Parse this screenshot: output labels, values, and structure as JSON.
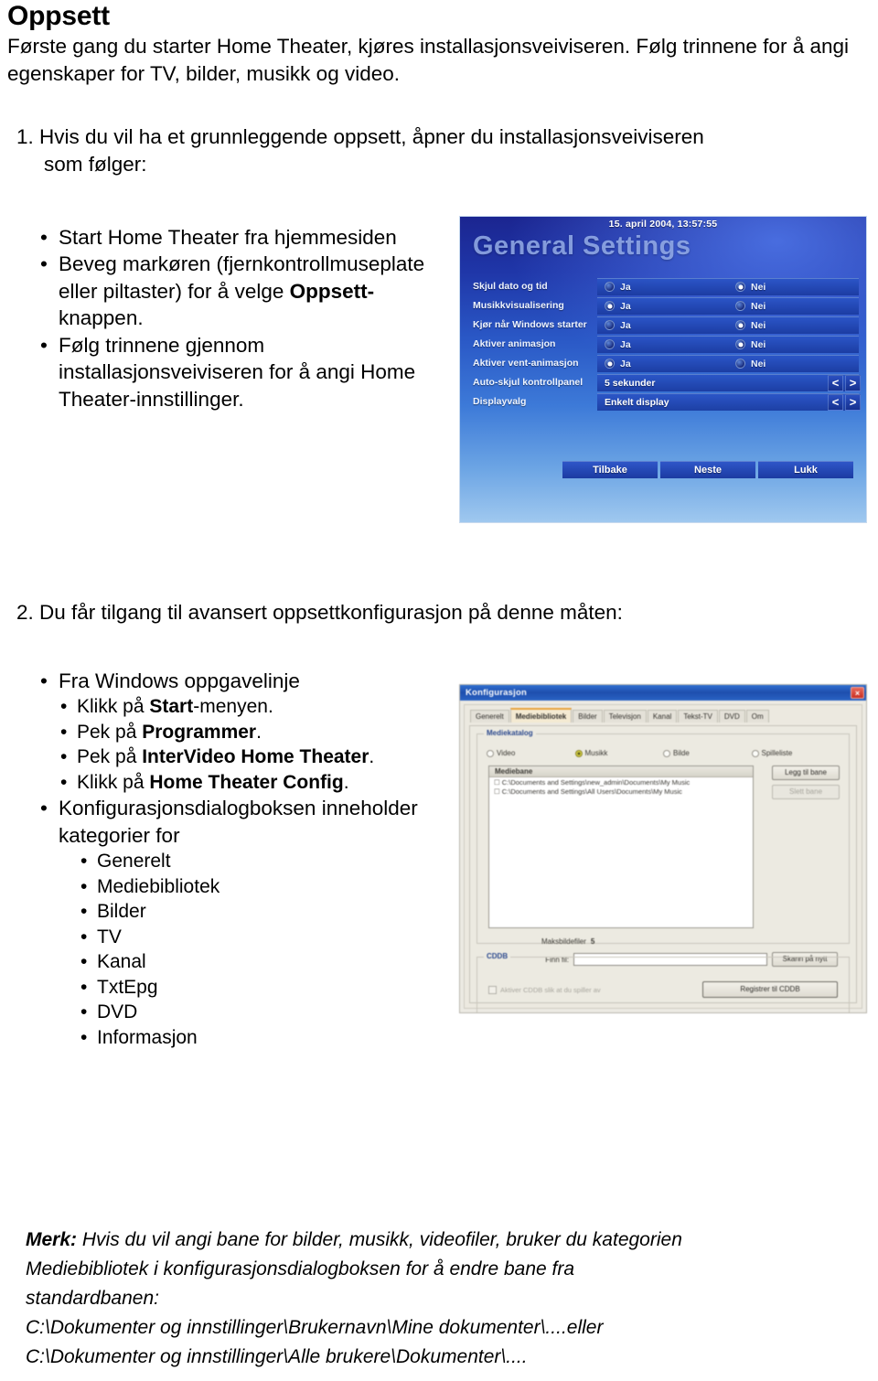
{
  "document": {
    "title": "Oppsett",
    "intro": "Første gang du starter Home Theater, kjøres installasjonsveiviseren. Følg trinnene for å angi egenskaper for TV, bilder, musikk og video.",
    "step1": {
      "number": "1.",
      "text": "Hvis du vil ha et grunnleggende oppsett, åpner du installasjonsveiviseren",
      "text_cont": "som følger:",
      "bullets": [
        {
          "parts": [
            {
              "t": "Start Home Theater fra hjemmesiden",
              "b": false
            }
          ]
        },
        {
          "parts": [
            {
              "t": "Beveg markøren (fjernkontrollmuseplate eller piltaster) for å velge ",
              "b": false
            },
            {
              "t": "Oppsett-",
              "b": true
            },
            {
              "t": "knappen.",
              "b": false
            }
          ]
        },
        {
          "parts": [
            {
              "t": "Følg trinnene gjennom installasjonsveiviseren for å angi Home Theater-innstillinger.",
              "b": false
            }
          ]
        }
      ]
    },
    "step2": {
      "number": "2.",
      "text": "Du får tilgang til avansert oppsettkonfigurasjon på denne måten:",
      "bullet_top": "Fra Windows oppgavelinje",
      "sub_bullets": [
        {
          "parts": [
            {
              "t": "Klikk på ",
              "b": false
            },
            {
              "t": "Start",
              "b": true
            },
            {
              "t": "-menyen.",
              "b": false
            }
          ]
        },
        {
          "parts": [
            {
              "t": "Pek på ",
              "b": false
            },
            {
              "t": "Programmer",
              "b": true
            },
            {
              "t": ".",
              "b": false
            }
          ]
        },
        {
          "parts": [
            {
              "t": "Pek på ",
              "b": false
            },
            {
              "t": "InterVideo Home Theater",
              "b": true
            },
            {
              "t": ".",
              "b": false
            }
          ]
        },
        {
          "parts": [
            {
              "t": "Klikk på ",
              "b": false
            },
            {
              "t": "Home Theater Config",
              "b": true
            },
            {
              "t": ".",
              "b": false
            }
          ]
        }
      ],
      "bullet_config": "Konfigurasjonsdialogboksen inneholder kategorier for",
      "categories": [
        "Generelt",
        "Mediebibliotek",
        "Bilder",
        "TV",
        "Kanal",
        "TxtEpg",
        "DVD",
        "Informasjon"
      ]
    },
    "note": {
      "lead": "Merk:",
      "line1": " Hvis du vil angi bane for bilder, musikk, videofiler, bruker du kategorien",
      "line2": "Mediebibliotek i konfigurasjonsdialogboksen for å endre bane fra",
      "line3": "standardbanen:",
      "line4": "C:\\Dokumenter og innstillinger\\Brukernavn\\Mine dokumenter\\....eller",
      "line5": "C:\\Dokumenter og innstillinger\\Alle brukere\\Dokumenter\\...."
    }
  },
  "general_settings_screenshot": {
    "datetime": "15. april 2004, 13:57:55",
    "title": "General Settings",
    "yes_label": "Ja",
    "no_label": "Nei",
    "rows": [
      {
        "label": "Skjul dato og tid",
        "type": "radio",
        "selected": "no"
      },
      {
        "label": "Musikkvisualisering",
        "type": "radio",
        "selected": "yes"
      },
      {
        "label": "Kjør når Windows starter",
        "type": "radio",
        "selected": "no"
      },
      {
        "label": "Aktiver animasjon",
        "type": "radio",
        "selected": "no"
      },
      {
        "label": "Aktiver vent-animasjon",
        "type": "radio",
        "selected": "yes"
      },
      {
        "label": "Auto-skjul kontrollpanel",
        "type": "spinner",
        "value": "5 sekunder"
      },
      {
        "label": "Displayvalg",
        "type": "spinner",
        "value": "Enkelt display"
      }
    ],
    "spinner_prev": "<",
    "spinner_next": ">",
    "buttons": [
      "Tilbake",
      "Neste",
      "Lukk"
    ],
    "colors": {
      "bg_top": "#1b2590",
      "bg_bottom": "#9fc8ef",
      "title_text": "#96afeb",
      "field": "#2a54c6"
    }
  },
  "config_dialog_screenshot": {
    "window_title": "Konfigurasjon",
    "close_label": "×",
    "tabs": [
      "Generelt",
      "Mediebibliotek",
      "Bilder",
      "Televisjon",
      "Kanal",
      "Tekst-TV",
      "DVD",
      "Om"
    ],
    "active_tab": "Mediebibliotek",
    "group_label": "Mediekatalog",
    "media_types": [
      {
        "label": "Video",
        "selected": false
      },
      {
        "label": "Musikk",
        "selected": true
      },
      {
        "label": "Bilde",
        "selected": false
      },
      {
        "label": "Spilleliste",
        "selected": false
      }
    ],
    "list_header": "Mediebane",
    "list_rows": [
      "C:\\Documents and Settings\\new_admin\\Documents\\My Music",
      "C:\\Documents and Settings\\All Users\\Documents\\My Music"
    ],
    "side_buttons": [
      {
        "label": "Legg til bane",
        "disabled": false
      },
      {
        "label": "Slett bane",
        "disabled": true
      }
    ],
    "max_label": "Maksbildefiler",
    "max_value": "5",
    "find_label": "Finn fil:",
    "find_value": "",
    "rescan_button": "Skann på nytt",
    "group2_label": "CDDB",
    "cd_checkbox_label": "Aktiver CDDB slik at du spiller av",
    "register_button": "Registrer til CDDB"
  }
}
